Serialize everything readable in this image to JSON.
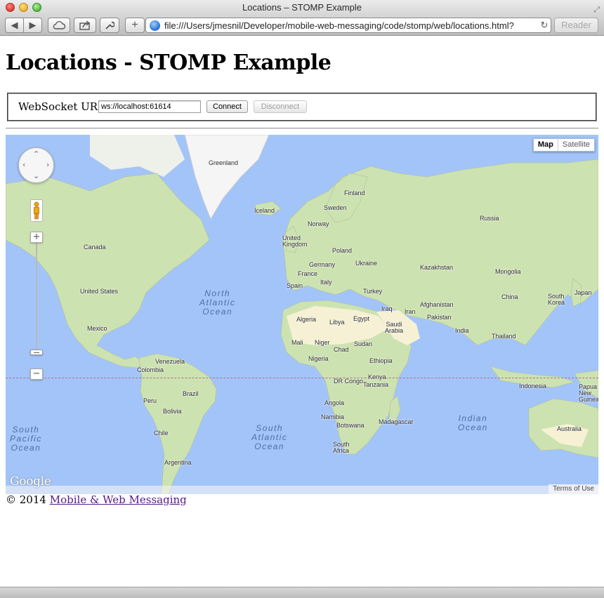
{
  "window": {
    "title": "Locations – STOMP Example",
    "url": "file:///Users/jmesnil/Developer/mobile-web-messaging/code/stomp/web/locations.html?",
    "reader_label": "Reader"
  },
  "page": {
    "title": "Locations - STOMP Example"
  },
  "connection": {
    "label": "WebSocket URL",
    "url_value": "ws://localhost:61614",
    "connect_label": "Connect",
    "disconnect_label": "Disconnect",
    "disconnect_enabled": false
  },
  "map": {
    "type_options": [
      "Map",
      "Satellite"
    ],
    "selected_type": "Map",
    "logo": "Google",
    "terms": "Terms of Use",
    "countries": [
      "Greenland",
      "Finland",
      "Sweden",
      "Iceland",
      "Norway",
      "Russia",
      "United Kingdom",
      "Poland",
      "Canada",
      "Germany",
      "Ukraine",
      "Kazakhstan",
      "France",
      "Mongolia",
      "Italy",
      "Spain",
      "United States",
      "Turkey",
      "China",
      "Japan",
      "South Korea",
      "Afghanistan",
      "Iraq",
      "Iran",
      "Algeria",
      "Libya",
      "Egypt",
      "Pakistan",
      "Saudi Arabia",
      "Mexico",
      "India",
      "Mali",
      "Niger",
      "Sudan",
      "Thailand",
      "Chad",
      "Nigeria",
      "Ethiopia",
      "Venezuela",
      "Colombia",
      "Kenya",
      "DR Congo",
      "Tanzania",
      "Indonesia",
      "Papua New Guinea",
      "Brazil",
      "Peru",
      "Angola",
      "Bolivia",
      "Namibia",
      "Madagascar",
      "Botswana",
      "Chile",
      "South Africa",
      "Australia",
      "Argentina"
    ],
    "oceans": {
      "north_atlantic": "North\nAtlantic\nOcean",
      "south_atlantic": "South\nAtlantic\nOcean",
      "south_pacific": "South\nPacific\nOcean",
      "indian": "Indian\nOcean"
    },
    "colors": {
      "water": "#a3c4f9",
      "land": "#cde2b1",
      "desert": "#f6f1d5",
      "ice": "#f5f5f5"
    }
  },
  "footer": {
    "copyright": "© 2014",
    "link_text": "Mobile & Web Messaging"
  }
}
